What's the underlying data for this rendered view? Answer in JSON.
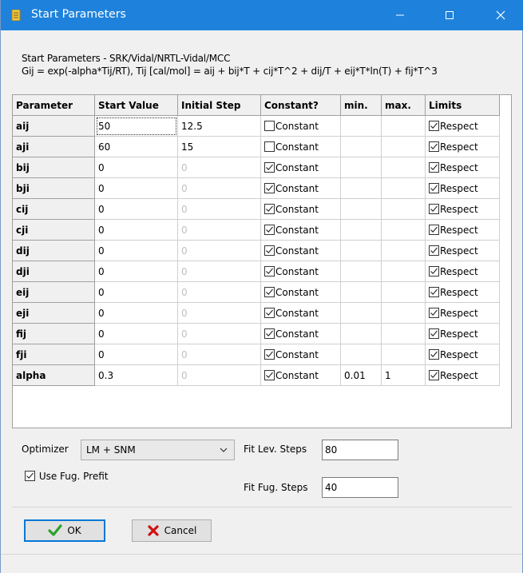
{
  "window": {
    "title": "Start Parameters",
    "controls": {
      "minimize": "—",
      "maximize": "☐",
      "close": "✕"
    }
  },
  "header": {
    "line1": "Start Parameters - SRK/Vidal/NRTL-Vidal/MCC",
    "line2": "Gij = exp(-alpha*Tij/RT), Tij [cal/mol] = aij + bij*T + cij*T^2 + dij/T + eij*T*ln(T) + fij*T^3"
  },
  "table": {
    "columns": [
      "Parameter",
      "Start Value",
      "Initial Step",
      "Constant?",
      "min.",
      "max.",
      "Limits"
    ],
    "rows": [
      {
        "param": "aij",
        "start": "50",
        "step": "12.5",
        "step_muted": false,
        "constant": false,
        "constant_label": "Constant",
        "min": "",
        "max": "",
        "limits": true,
        "limits_label": "Respect"
      },
      {
        "param": "aji",
        "start": "60",
        "step": "15",
        "step_muted": false,
        "constant": false,
        "constant_label": "Constant",
        "min": "",
        "max": "",
        "limits": true,
        "limits_label": "Respect"
      },
      {
        "param": "bij",
        "start": "0",
        "step": "0",
        "step_muted": true,
        "constant": true,
        "constant_label": "Constant",
        "min": "",
        "max": "",
        "limits": true,
        "limits_label": "Respect"
      },
      {
        "param": "bji",
        "start": "0",
        "step": "0",
        "step_muted": true,
        "constant": true,
        "constant_label": "Constant",
        "min": "",
        "max": "",
        "limits": true,
        "limits_label": "Respect"
      },
      {
        "param": "cij",
        "start": "0",
        "step": "0",
        "step_muted": true,
        "constant": true,
        "constant_label": "Constant",
        "min": "",
        "max": "",
        "limits": true,
        "limits_label": "Respect"
      },
      {
        "param": "cji",
        "start": "0",
        "step": "0",
        "step_muted": true,
        "constant": true,
        "constant_label": "Constant",
        "min": "",
        "max": "",
        "limits": true,
        "limits_label": "Respect"
      },
      {
        "param": "dij",
        "start": "0",
        "step": "0",
        "step_muted": true,
        "constant": true,
        "constant_label": "Constant",
        "min": "",
        "max": "",
        "limits": true,
        "limits_label": "Respect"
      },
      {
        "param": "dji",
        "start": "0",
        "step": "0",
        "step_muted": true,
        "constant": true,
        "constant_label": "Constant",
        "min": "",
        "max": "",
        "limits": true,
        "limits_label": "Respect"
      },
      {
        "param": "eij",
        "start": "0",
        "step": "0",
        "step_muted": true,
        "constant": true,
        "constant_label": "Constant",
        "min": "",
        "max": "",
        "limits": true,
        "limits_label": "Respect"
      },
      {
        "param": "eji",
        "start": "0",
        "step": "0",
        "step_muted": true,
        "constant": true,
        "constant_label": "Constant",
        "min": "",
        "max": "",
        "limits": true,
        "limits_label": "Respect"
      },
      {
        "param": "fij",
        "start": "0",
        "step": "0",
        "step_muted": true,
        "constant": true,
        "constant_label": "Constant",
        "min": "",
        "max": "",
        "limits": true,
        "limits_label": "Respect"
      },
      {
        "param": "fji",
        "start": "0",
        "step": "0",
        "step_muted": true,
        "constant": true,
        "constant_label": "Constant",
        "min": "",
        "max": "",
        "limits": true,
        "limits_label": "Respect"
      },
      {
        "param": "alpha",
        "start": "0.3",
        "step": "0",
        "step_muted": true,
        "constant": true,
        "constant_label": "Constant",
        "min": "0.01",
        "max": "1",
        "limits": true,
        "limits_label": "Respect"
      }
    ]
  },
  "options": {
    "optimizer_label": "Optimizer",
    "optimizer_value": "LM + SNM",
    "use_fug_prefit_label": "Use Fug. Prefit",
    "use_fug_prefit_checked": true,
    "fit_lev_steps_label": "Fit Lev. Steps",
    "fit_lev_steps_value": "80",
    "fit_fug_steps_label": "Fit Fug. Steps",
    "fit_fug_steps_value": "40"
  },
  "buttons": {
    "ok": "OK",
    "cancel": "Cancel"
  },
  "colors": {
    "titlebar": "#1e82dc",
    "ok_check": "#2aa02a",
    "cancel_x": "#d01010"
  }
}
